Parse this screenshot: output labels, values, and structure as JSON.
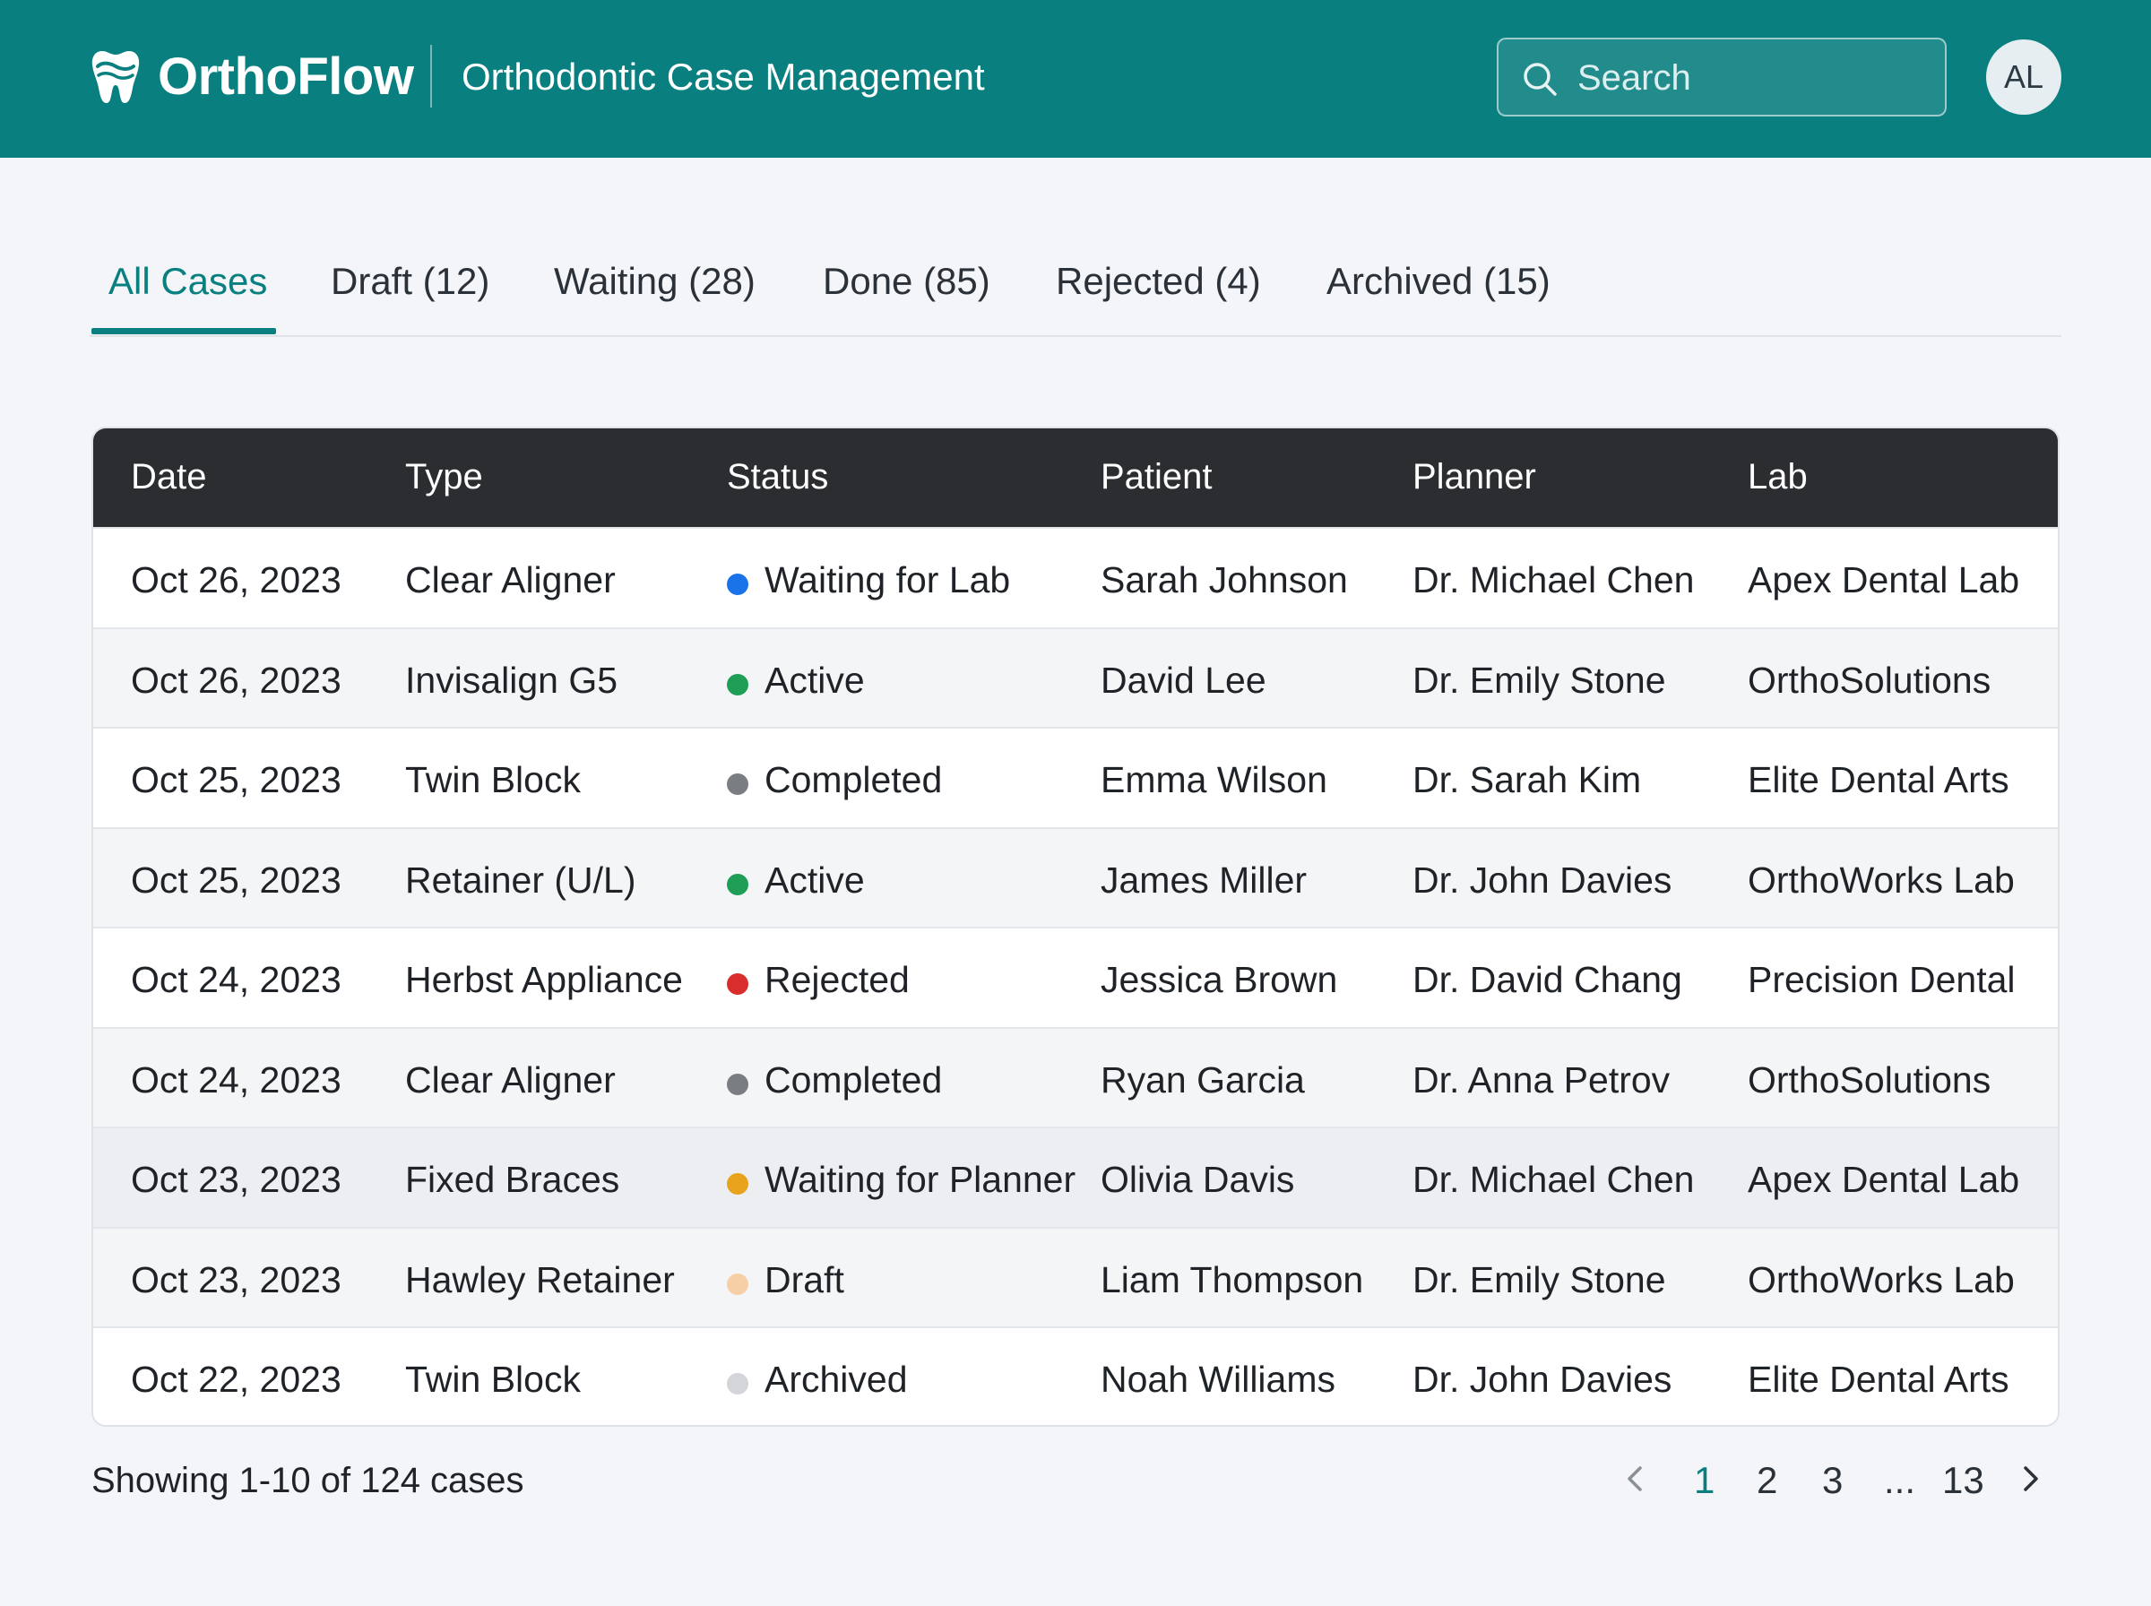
{
  "header": {
    "app_name": "OrthoFlow",
    "app_subtitle": "Orthodontic Case Management",
    "search_placeholder": "Search",
    "avatar_initials": "AL",
    "logo_icon": "tooth-icon",
    "search_icon": "search-icon",
    "brand_color": "#0a7f80"
  },
  "tabs": [
    {
      "label": "All Cases",
      "active": true
    },
    {
      "label": "Draft (12)",
      "active": false
    },
    {
      "label": "Waiting (28)",
      "active": false
    },
    {
      "label": "Done (85)",
      "active": false
    },
    {
      "label": "Rejected (4)",
      "active": false
    },
    {
      "label": "Archived (15)",
      "active": false
    }
  ],
  "table": {
    "columns": [
      "Date",
      "Type",
      "Status",
      "Patient",
      "Planner",
      "Lab"
    ],
    "rows": [
      {
        "date": "Oct 26, 2023",
        "type": "Clear Aligner",
        "status": "Waiting for Lab",
        "status_color": "#1a73e8",
        "patient": "Sarah Johnson",
        "planner": "Dr. Michael Chen",
        "lab": "Apex Dental Lab"
      },
      {
        "date": "Oct 26, 2023",
        "type": "Invisalign G5",
        "status": "Active",
        "status_color": "#1e9e57",
        "patient": "David Lee",
        "planner": "Dr. Emily Stone",
        "lab": "OrthoSolutions"
      },
      {
        "date": "Oct 25, 2023",
        "type": "Twin Block",
        "status": "Completed",
        "status_color": "#7a7d82",
        "patient": "Emma Wilson",
        "planner": "Dr. Sarah Kim",
        "lab": "Elite Dental Arts"
      },
      {
        "date": "Oct 25, 2023",
        "type": "Retainer (U/L)",
        "status": "Active",
        "status_color": "#1e9e57",
        "patient": "James Miller",
        "planner": "Dr. John Davies",
        "lab": "OrthoWorks Lab"
      },
      {
        "date": "Oct 24, 2023",
        "type": "Herbst Appliance",
        "status": "Rejected",
        "status_color": "#d92d2d",
        "patient": "Jessica Brown",
        "planner": "Dr. David Chang",
        "lab": "Precision Dental"
      },
      {
        "date": "Oct 24, 2023",
        "type": "Clear Aligner",
        "status": "Completed",
        "status_color": "#7a7d82",
        "patient": "Ryan Garcia",
        "planner": "Dr. Anna Petrov",
        "lab": "OrthoSolutions"
      },
      {
        "date": "Oct 23, 2023",
        "type": "Fixed Braces",
        "status": "Waiting for Planner",
        "status_color": "#e8a21c",
        "patient": "Olivia Davis",
        "planner": "Dr. Michael Chen",
        "lab": "Apex Dental Lab"
      },
      {
        "date": "Oct 23, 2023",
        "type": "Hawley Retainer",
        "status": "Draft",
        "status_color": "#f6cfa6",
        "patient": "Liam Thompson",
        "planner": "Dr. Emily Stone",
        "lab": "OrthoWorks Lab"
      },
      {
        "date": "Oct 22, 2023",
        "type": "Twin Block",
        "status": "Archived",
        "status_color": "#d3d5d9",
        "patient": "Noah Williams",
        "planner": "Dr. John Davies",
        "lab": "Elite Dental Arts"
      }
    ]
  },
  "footer": {
    "summary": "Showing 1-10 of 124 cases",
    "pages": [
      "1",
      "2",
      "3",
      "...",
      "13"
    ],
    "current_page": "1",
    "prev_icon": "chevron-left-icon",
    "next_icon": "chevron-right-icon"
  }
}
